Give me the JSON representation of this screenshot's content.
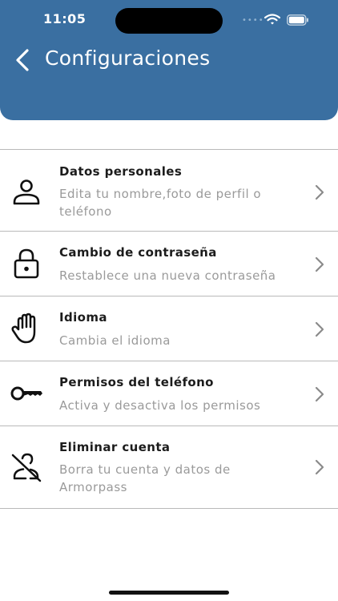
{
  "status_bar": {
    "time": "11:05",
    "dots": "••••"
  },
  "header": {
    "title": "Configuraciones"
  },
  "colors": {
    "header_bg": "#3a6fa1",
    "divider": "#b9b9b9",
    "title_text": "#1c1c1c",
    "subtitle_text": "#9a9a9a"
  },
  "items": [
    {
      "title": "Datos personales",
      "subtitle": "Edita tu nombre,foto de perfil o teléfono",
      "icon": "person-icon"
    },
    {
      "title": "Cambio de contraseña",
      "subtitle": "Restablece una nueva contraseña",
      "icon": "lock-icon"
    },
    {
      "title": "Idioma",
      "subtitle": "Cambia el idioma",
      "icon": "hand-icon"
    },
    {
      "title": "Permisos del teléfono",
      "subtitle": "Activa y desactiva los permisos",
      "icon": "key-icon"
    },
    {
      "title": "Eliminar cuenta",
      "subtitle": "Borra tu cuenta y datos de Armorpass",
      "icon": "person-off-icon"
    }
  ]
}
